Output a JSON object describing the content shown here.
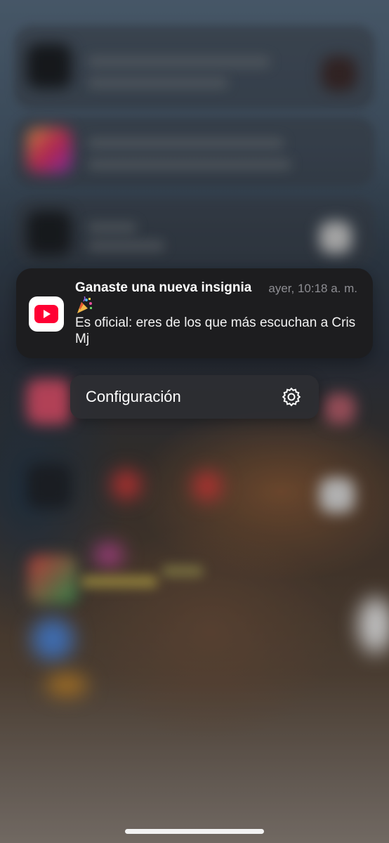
{
  "notification": {
    "app_icon": "youtube-music-icon",
    "title": "Ganaste una nueva insignia",
    "emoji": "🎉",
    "emoji_icon": "party-popper-icon",
    "time": "ayer, 10:18 a. m.",
    "body": "Es oficial: eres de los que más escuchan a Cris Mj"
  },
  "menu": {
    "item_label": "Configuración",
    "item_icon": "gear-icon"
  },
  "colors": {
    "accent_red": "#ff0033",
    "card_bg": "#1d1d1f",
    "menu_bg": "#2c2e32"
  }
}
